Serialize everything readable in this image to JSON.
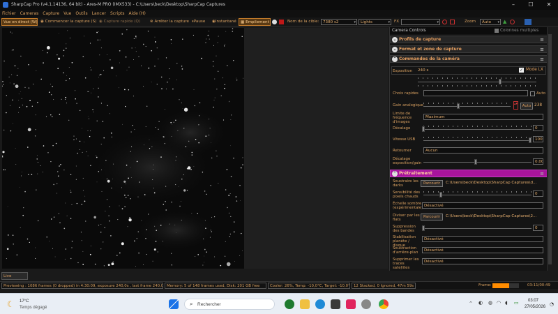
{
  "window": {
    "title": "SharpCap Pro (v4.1.14136, 64 bit) - Ares-M PRO (IMX533) - C:\\Users\\beck\\Desktop\\SharpCap Captures"
  },
  "menu": [
    "Fichier",
    "Cameras",
    "Capture",
    "Vue",
    "Outils",
    "Lancer",
    "Scripts",
    "Aide (H)"
  ],
  "toolbar": {
    "live_view": "Vue en direct (W)",
    "start_capture": "Commencer la capture (S)",
    "quick_capture": "Capture rapide (Q)",
    "stop_capture": "Arrêter la capture",
    "pause": "Pause",
    "snapshot": "Instantané",
    "stacking": "Empilement",
    "target_label": "Nom de la cible:",
    "target_value": "7380 s2",
    "frame_type": "Lights",
    "fx_label": "FX",
    "fx_value": "",
    "zoom_label": "Zoom",
    "zoom_value": "Auto"
  },
  "panel": {
    "header": "Camera Controls",
    "multi_columns": "Colonnes multiples",
    "sections": {
      "profiles": "Profils de capture",
      "format": "Format et zone de capture",
      "camera": "Commandes de la caméra",
      "preprocessing": "Prétraitement"
    },
    "exposure_label": "Exposition",
    "exposure_value": "240 s",
    "lx_mode": "Mode LX",
    "quick_choices": "Choix rapides",
    "auto_label": "Auto",
    "gain_label": "Gain analogique",
    "gain_value": "238",
    "gain_auto": "Auto",
    "framerate_label": "Limite de fréquence d'images",
    "framerate_value": "Maximum",
    "offset_label": "Décalage",
    "offset_value": "0",
    "usb_label": "Vitesse USB",
    "usb_value": "100",
    "flip_label": "Retourner",
    "flip_value": "Aucun",
    "expgain_label": "Décalage exposition/gain",
    "expgain_value": "0,00",
    "darks_label": "Soustraire les darks",
    "browse": "Parcourir",
    "darks_path": "C:\\Users\\beck\\Desktop\\SharpCap Captures\\d...",
    "hotpix_label": "Sensibilité des pixels chauds",
    "hotpix_value": "0",
    "darkscale_label": "Échelle sombre (expérimentale)",
    "darkscale_value": "Désactivé",
    "flats_label": "Diviser par les flats",
    "flats_path": "C:\\Users\\beck\\Desktop\\SharpCap Captures\\2...",
    "banding_label": "Suppression des bandes",
    "banding_value": "0",
    "stab_label": "Stabilisation planète / disque",
    "stab_value": "Désactivé",
    "bg_label": "Soustraction d'arrière-plan",
    "bg_value": "Désactivé",
    "sat_label": "Supprimer les traces satellites (après le",
    "sat_value": "Désactivé"
  },
  "live_stacking_tab": "Live Stacking",
  "status": {
    "preview": "Previewing : 1086 frames (0 dropped) in 4:30:09, exposure 240,0s , last frame 240,0s",
    "memory": "Memory: 5 of 148 frames used, Disk: 201 GB free",
    "cooler": "Cooler: 26%, Temp: -10,0°C, Target: -10,0°",
    "stacked": "12 Stacked, 0 Ignored, 47m 59s",
    "frame_label": "Frame:",
    "frame_time": "03:11/00:49",
    "frame_progress": 0.62
  },
  "taskbar": {
    "weather_temp": "17°C",
    "weather_desc": "Temps dégagé",
    "search": "Rechercher",
    "time": "03:07",
    "date": "27/05/2026"
  },
  "colors": {
    "accent": "#d8a060",
    "section_highlight": "#a8149c",
    "progress": "#ff8c00"
  }
}
